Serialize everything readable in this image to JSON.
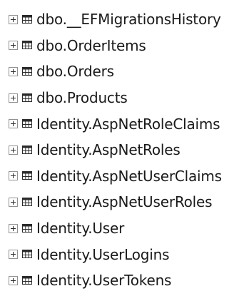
{
  "tree": {
    "items": [
      {
        "label": "dbo.__EFMigrationsHistory"
      },
      {
        "label": "dbo.OrderItems"
      },
      {
        "label": "dbo.Orders"
      },
      {
        "label": "dbo.Products"
      },
      {
        "label": "Identity.AspNetRoleClaims"
      },
      {
        "label": "Identity.AspNetRoles"
      },
      {
        "label": "Identity.AspNetUserClaims"
      },
      {
        "label": "Identity.AspNetUserRoles"
      },
      {
        "label": "Identity.User"
      },
      {
        "label": "Identity.UserLogins"
      },
      {
        "label": "Identity.UserTokens"
      }
    ],
    "expander_icon": "plus-box-icon",
    "item_icon": "table-icon"
  }
}
